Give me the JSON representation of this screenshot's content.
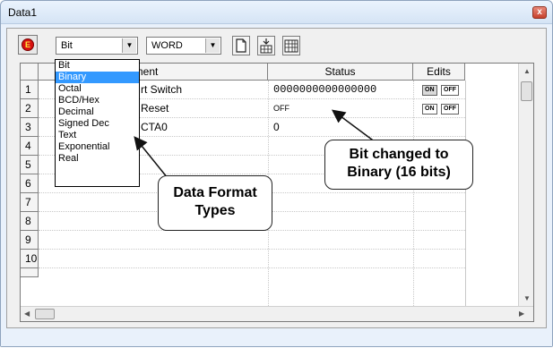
{
  "window": {
    "title": "Data1",
    "close_glyph": "x"
  },
  "toolbar": {
    "stop_glyph": "E",
    "format_combo": {
      "value": "Bit"
    },
    "size_combo": {
      "value": "WORD"
    },
    "buttons": [
      "new-page-icon",
      "insert-row-icon",
      "grid-icon"
    ]
  },
  "dropdown": {
    "items": [
      "Bit",
      "Binary",
      "Octal",
      "BCD/Hex",
      "Decimal",
      "Signed Dec",
      "Text",
      "Exponential",
      "Real"
    ],
    "selected_index": 1
  },
  "table": {
    "headers": {
      "element": "ement",
      "status": "Status",
      "edits": "Edits"
    },
    "row_numbers": [
      "1",
      "2",
      "3",
      "4",
      "5",
      "6",
      "7",
      "8",
      "9",
      "10"
    ],
    "rows": [
      {
        "element": "rt Switch",
        "status": "0000000000000000",
        "edit_on": "ON",
        "edit_off": "OFF"
      },
      {
        "element": "Reset",
        "status": "OFF",
        "edit_on": "ON",
        "edit_off": "OFF"
      },
      {
        "element": "CTA0",
        "status": "0"
      }
    ]
  },
  "callouts": {
    "data_format": "Data Format Types",
    "bit_changed": "Bit changed to Binary (16 bits)"
  }
}
